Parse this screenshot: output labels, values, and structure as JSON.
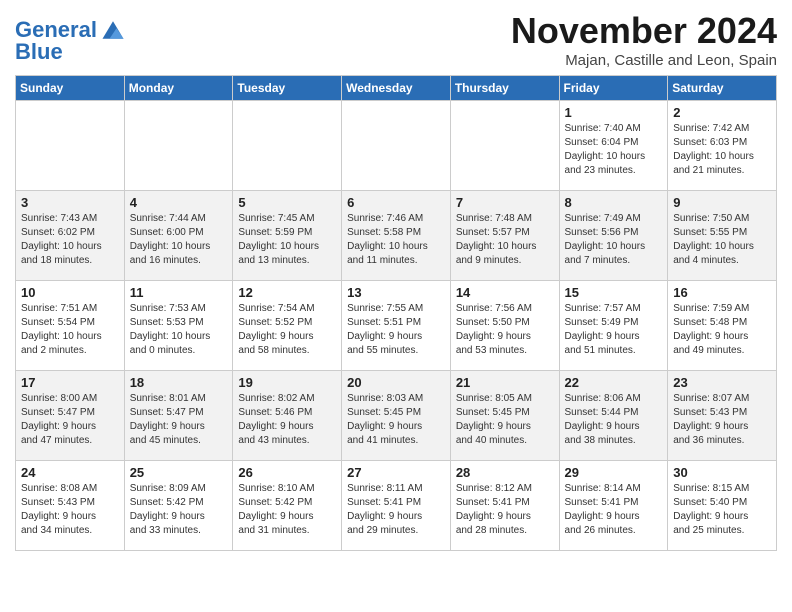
{
  "logo": {
    "line1": "General",
    "line2": "Blue"
  },
  "title": "November 2024",
  "location": "Majan, Castille and Leon, Spain",
  "weekdays": [
    "Sunday",
    "Monday",
    "Tuesday",
    "Wednesday",
    "Thursday",
    "Friday",
    "Saturday"
  ],
  "weeks": [
    [
      {
        "day": "",
        "info": ""
      },
      {
        "day": "",
        "info": ""
      },
      {
        "day": "",
        "info": ""
      },
      {
        "day": "",
        "info": ""
      },
      {
        "day": "",
        "info": ""
      },
      {
        "day": "1",
        "info": "Sunrise: 7:40 AM\nSunset: 6:04 PM\nDaylight: 10 hours\nand 23 minutes."
      },
      {
        "day": "2",
        "info": "Sunrise: 7:42 AM\nSunset: 6:03 PM\nDaylight: 10 hours\nand 21 minutes."
      }
    ],
    [
      {
        "day": "3",
        "info": "Sunrise: 7:43 AM\nSunset: 6:02 PM\nDaylight: 10 hours\nand 18 minutes."
      },
      {
        "day": "4",
        "info": "Sunrise: 7:44 AM\nSunset: 6:00 PM\nDaylight: 10 hours\nand 16 minutes."
      },
      {
        "day": "5",
        "info": "Sunrise: 7:45 AM\nSunset: 5:59 PM\nDaylight: 10 hours\nand 13 minutes."
      },
      {
        "day": "6",
        "info": "Sunrise: 7:46 AM\nSunset: 5:58 PM\nDaylight: 10 hours\nand 11 minutes."
      },
      {
        "day": "7",
        "info": "Sunrise: 7:48 AM\nSunset: 5:57 PM\nDaylight: 10 hours\nand 9 minutes."
      },
      {
        "day": "8",
        "info": "Sunrise: 7:49 AM\nSunset: 5:56 PM\nDaylight: 10 hours\nand 7 minutes."
      },
      {
        "day": "9",
        "info": "Sunrise: 7:50 AM\nSunset: 5:55 PM\nDaylight: 10 hours\nand 4 minutes."
      }
    ],
    [
      {
        "day": "10",
        "info": "Sunrise: 7:51 AM\nSunset: 5:54 PM\nDaylight: 10 hours\nand 2 minutes."
      },
      {
        "day": "11",
        "info": "Sunrise: 7:53 AM\nSunset: 5:53 PM\nDaylight: 10 hours\nand 0 minutes."
      },
      {
        "day": "12",
        "info": "Sunrise: 7:54 AM\nSunset: 5:52 PM\nDaylight: 9 hours\nand 58 minutes."
      },
      {
        "day": "13",
        "info": "Sunrise: 7:55 AM\nSunset: 5:51 PM\nDaylight: 9 hours\nand 55 minutes."
      },
      {
        "day": "14",
        "info": "Sunrise: 7:56 AM\nSunset: 5:50 PM\nDaylight: 9 hours\nand 53 minutes."
      },
      {
        "day": "15",
        "info": "Sunrise: 7:57 AM\nSunset: 5:49 PM\nDaylight: 9 hours\nand 51 minutes."
      },
      {
        "day": "16",
        "info": "Sunrise: 7:59 AM\nSunset: 5:48 PM\nDaylight: 9 hours\nand 49 minutes."
      }
    ],
    [
      {
        "day": "17",
        "info": "Sunrise: 8:00 AM\nSunset: 5:47 PM\nDaylight: 9 hours\nand 47 minutes."
      },
      {
        "day": "18",
        "info": "Sunrise: 8:01 AM\nSunset: 5:47 PM\nDaylight: 9 hours\nand 45 minutes."
      },
      {
        "day": "19",
        "info": "Sunrise: 8:02 AM\nSunset: 5:46 PM\nDaylight: 9 hours\nand 43 minutes."
      },
      {
        "day": "20",
        "info": "Sunrise: 8:03 AM\nSunset: 5:45 PM\nDaylight: 9 hours\nand 41 minutes."
      },
      {
        "day": "21",
        "info": "Sunrise: 8:05 AM\nSunset: 5:45 PM\nDaylight: 9 hours\nand 40 minutes."
      },
      {
        "day": "22",
        "info": "Sunrise: 8:06 AM\nSunset: 5:44 PM\nDaylight: 9 hours\nand 38 minutes."
      },
      {
        "day": "23",
        "info": "Sunrise: 8:07 AM\nSunset: 5:43 PM\nDaylight: 9 hours\nand 36 minutes."
      }
    ],
    [
      {
        "day": "24",
        "info": "Sunrise: 8:08 AM\nSunset: 5:43 PM\nDaylight: 9 hours\nand 34 minutes."
      },
      {
        "day": "25",
        "info": "Sunrise: 8:09 AM\nSunset: 5:42 PM\nDaylight: 9 hours\nand 33 minutes."
      },
      {
        "day": "26",
        "info": "Sunrise: 8:10 AM\nSunset: 5:42 PM\nDaylight: 9 hours\nand 31 minutes."
      },
      {
        "day": "27",
        "info": "Sunrise: 8:11 AM\nSunset: 5:41 PM\nDaylight: 9 hours\nand 29 minutes."
      },
      {
        "day": "28",
        "info": "Sunrise: 8:12 AM\nSunset: 5:41 PM\nDaylight: 9 hours\nand 28 minutes."
      },
      {
        "day": "29",
        "info": "Sunrise: 8:14 AM\nSunset: 5:41 PM\nDaylight: 9 hours\nand 26 minutes."
      },
      {
        "day": "30",
        "info": "Sunrise: 8:15 AM\nSunset: 5:40 PM\nDaylight: 9 hours\nand 25 minutes."
      }
    ]
  ]
}
